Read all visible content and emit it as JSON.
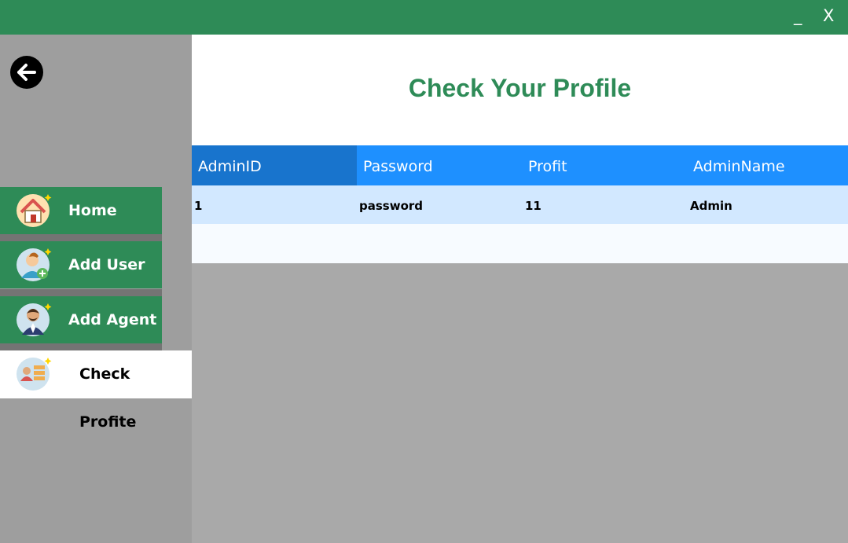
{
  "window": {
    "minimize_label": "_",
    "close_label": "X",
    "accent_color": "#2e8b57"
  },
  "sidebar": {
    "back_icon": "arrow-left-icon",
    "items": [
      {
        "label": "Home",
        "icon": "house-icon",
        "active": false
      },
      {
        "label": "Add User",
        "icon": "add-user-icon",
        "active": false
      },
      {
        "label": "Add Agent",
        "icon": "agent-icon",
        "active": false
      },
      {
        "label": "Check Profite",
        "icon": "profile-list-icon",
        "active": true
      }
    ]
  },
  "main": {
    "title": "Check Your Profile",
    "table": {
      "columns": [
        "AdminID",
        "Password",
        "Profit",
        "AdminName"
      ],
      "rows": [
        [
          "1",
          "password",
          "11",
          "Admin"
        ]
      ],
      "header_color": "#1e90ff",
      "selected_header_color": "#1874cd",
      "row_color": "#d2e8ff"
    }
  }
}
